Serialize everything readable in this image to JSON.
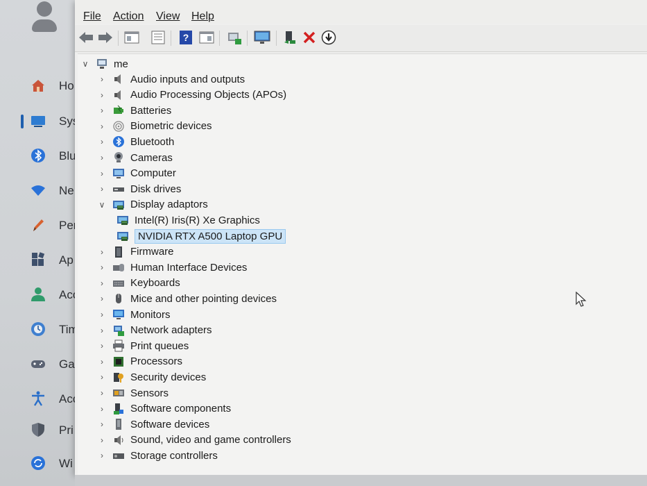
{
  "settings": {
    "nav": [
      {
        "label": "Ho",
        "icon": "home-icon"
      },
      {
        "label": "Sys",
        "icon": "system-icon"
      },
      {
        "label": "Blu",
        "icon": "bluetooth-icon"
      },
      {
        "label": "Ne",
        "icon": "network-icon"
      },
      {
        "label": "Per",
        "icon": "personalisation-icon"
      },
      {
        "label": "Ap",
        "icon": "apps-icon"
      },
      {
        "label": "Acc",
        "icon": "accounts-icon"
      },
      {
        "label": "Tim",
        "icon": "time-icon"
      },
      {
        "label": "Ga",
        "icon": "gaming-icon"
      },
      {
        "label": "Acc",
        "icon": "accessibility-icon"
      },
      {
        "label": "Pri",
        "icon": "privacy-icon"
      },
      {
        "label": "Wi",
        "icon": "windows-update-icon"
      }
    ]
  },
  "menu": {
    "file": "File",
    "action": "Action",
    "view": "View",
    "help": "Help"
  },
  "toolbar": [
    "back-icon",
    "forward-icon",
    "properties-icon",
    "details-icon",
    "help-icon",
    "view-icon",
    "scan-hardware-icon",
    "monitor-icon",
    "enable-device-icon",
    "uninstall-icon",
    "update-driver-icon"
  ],
  "tree": {
    "root": "me",
    "categories": [
      {
        "label": "Audio inputs and outputs",
        "icon": "speaker-icon"
      },
      {
        "label": "Audio Processing Objects (APOs)",
        "icon": "speaker-icon"
      },
      {
        "label": "Batteries",
        "icon": "battery-icon"
      },
      {
        "label": "Biometric devices",
        "icon": "fingerprint-icon"
      },
      {
        "label": "Bluetooth",
        "icon": "bluetooth-icon"
      },
      {
        "label": "Cameras",
        "icon": "camera-icon"
      },
      {
        "label": "Computer",
        "icon": "computer-icon"
      },
      {
        "label": "Disk drives",
        "icon": "disk-icon"
      },
      {
        "label": "Display adaptors",
        "icon": "display-adapter-icon",
        "expanded": true,
        "children": [
          {
            "label": "Intel(R) Iris(R) Xe Graphics",
            "icon": "display-adapter-icon"
          },
          {
            "label": "NVIDIA RTX A500 Laptop GPU",
            "icon": "display-adapter-icon",
            "selected": true
          }
        ]
      },
      {
        "label": "Firmware",
        "icon": "firmware-icon"
      },
      {
        "label": "Human Interface Devices",
        "icon": "hid-icon"
      },
      {
        "label": "Keyboards",
        "icon": "keyboard-icon"
      },
      {
        "label": "Mice and other pointing devices",
        "icon": "mouse-icon"
      },
      {
        "label": "Monitors",
        "icon": "monitor-icon"
      },
      {
        "label": "Network adapters",
        "icon": "network-adapter-icon"
      },
      {
        "label": "Print queues",
        "icon": "printer-icon"
      },
      {
        "label": "Processors",
        "icon": "processor-icon"
      },
      {
        "label": "Security devices",
        "icon": "security-device-icon"
      },
      {
        "label": "Sensors",
        "icon": "sensor-icon"
      },
      {
        "label": "Software components",
        "icon": "software-component-icon"
      },
      {
        "label": "Software devices",
        "icon": "software-device-icon"
      },
      {
        "label": "Sound, video and game controllers",
        "icon": "sound-icon"
      },
      {
        "label": "Storage controllers",
        "icon": "storage-icon"
      }
    ]
  },
  "colors": {
    "accent": "#1e5fae",
    "selection": "#cce4f7",
    "uninstall": "#d32020",
    "enable": "#2b8a3e"
  }
}
